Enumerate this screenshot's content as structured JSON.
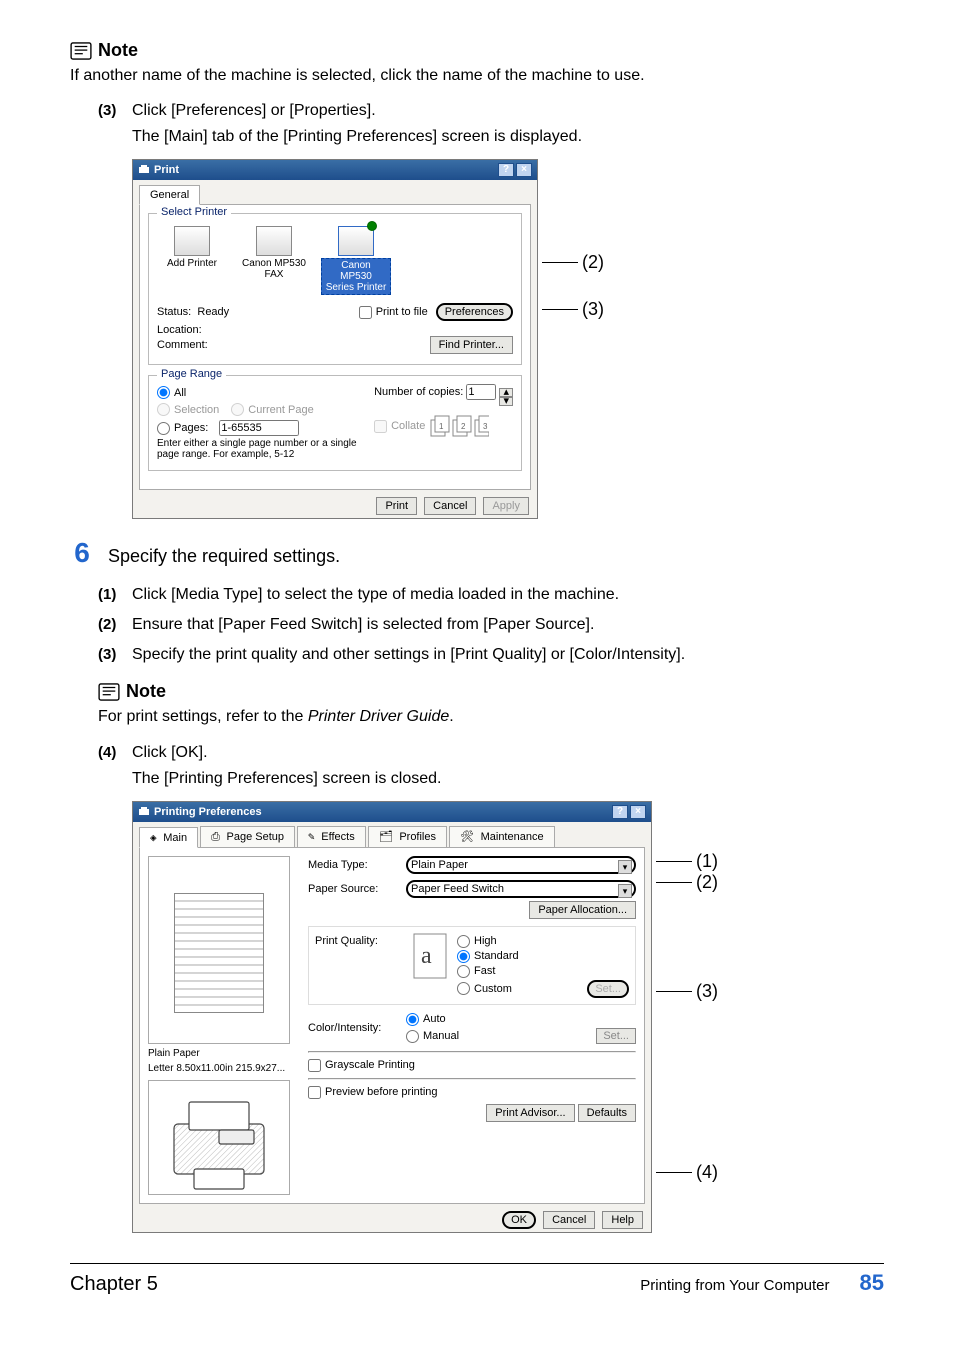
{
  "note_label": "Note",
  "note1_text": "If another name of the machine is selected, click the name of the machine to use.",
  "steps_top": {
    "s3_num": "(3)",
    "s3_text": "Click [Preferences] or [Properties].",
    "s3_sub": "The [Main] tab of the [Printing Preferences] screen is displayed."
  },
  "callouts_print": {
    "c2": "(2)",
    "c3": "(3)"
  },
  "print_dialog": {
    "title": "Print",
    "tab_general": "General",
    "grp_select_printer": "Select Printer",
    "printers": {
      "add": "Add Printer",
      "fax": "Canon MP530\nFAX",
      "series": "Canon MP530\nSeries Printer"
    },
    "status_lbl": "Status:",
    "status_val": "Ready",
    "location_lbl": "Location:",
    "comment_lbl": "Comment:",
    "print_to_file": "Print to file",
    "preferences": "Preferences",
    "find_printer": "Find Printer...",
    "grp_page_range": "Page Range",
    "all": "All",
    "selection": "Selection",
    "current_page": "Current Page",
    "pages": "Pages:",
    "pages_val": "1-65535",
    "pages_help": "Enter either a single page number or a single\npage range.  For example, 5-12",
    "copies_lbl": "Number of copies:",
    "copies_val": "1",
    "collate": "Collate",
    "btn_print": "Print",
    "btn_cancel": "Cancel",
    "btn_apply": "Apply"
  },
  "big_step": {
    "num": "6",
    "text": "Specify the required settings."
  },
  "steps_mid": {
    "s1": {
      "num": "(1)",
      "text": "Click [Media Type] to select the type of media loaded in the machine."
    },
    "s2": {
      "num": "(2)",
      "text": "Ensure that [Paper Feed Switch] is selected from [Paper Source]."
    },
    "s3": {
      "num": "(3)",
      "text": "Specify the print quality and other settings in [Print Quality] or [Color/Intensity]."
    }
  },
  "note2_text_a": "For print settings, refer to the ",
  "note2_text_b": "Printer Driver Guide",
  "note2_text_c": ".",
  "steps_bot": {
    "s4_num": "(4)",
    "s4_text": "Click [OK].",
    "s4_sub": "The [Printing Preferences] screen is closed."
  },
  "pref_dialog": {
    "title": "Printing Preferences",
    "tabs": {
      "main": "Main",
      "page_setup": "Page Setup",
      "effects": "Effects",
      "profiles": "Profiles",
      "maintenance": "Maintenance"
    },
    "media_type_lbl": "Media Type:",
    "media_type_val": "Plain Paper",
    "paper_source_lbl": "Paper Source:",
    "paper_source_val": "Paper Feed Switch",
    "paper_allocation": "Paper Allocation...",
    "print_quality_lbl": "Print Quality:",
    "q_high": "High",
    "q_standard": "Standard",
    "q_fast": "Fast",
    "q_custom": "Custom",
    "set": "Set...",
    "color_lbl": "Color/Intensity:",
    "c_auto": "Auto",
    "c_manual": "Manual",
    "grayscale": "Grayscale Printing",
    "preview_before": "Preview before printing",
    "preview_sub_a": "Plain Paper",
    "preview_sub_b": "Letter 8.50x11.00in 215.9x27...",
    "print_advisor": "Print Advisor...",
    "defaults": "Defaults",
    "ok": "OK",
    "cancel": "Cancel",
    "help": "Help"
  },
  "callouts_pref": {
    "c1": "(1)",
    "c2": "(2)",
    "c3": "(3)",
    "c4": "(4)"
  },
  "footer": {
    "chapter": "Chapter 5",
    "section": "Printing from Your Computer",
    "page": "85"
  }
}
